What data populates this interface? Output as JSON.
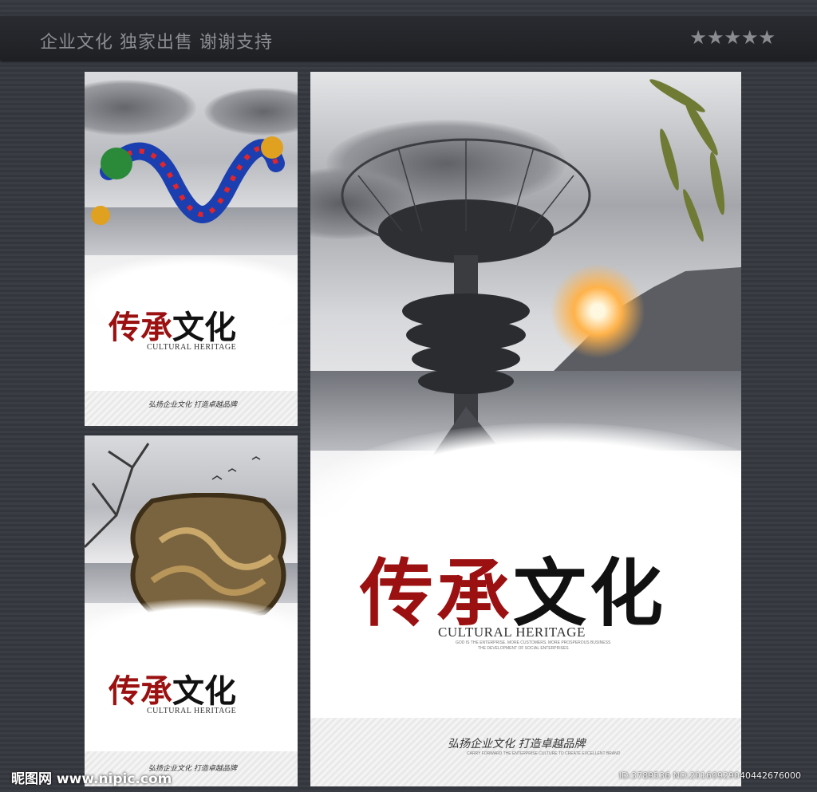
{
  "header": {
    "title": "企业文化  独家出售  谢谢支持",
    "stars": "★★★★★"
  },
  "posters": {
    "small_top": {
      "title_red": "传承",
      "title_black": "文化",
      "english": "CULTURAL HERITAGE",
      "slogan": "弘扬企业文化  打造卓越品牌"
    },
    "small_bottom": {
      "title_red": "传承",
      "title_black": "文化",
      "english": "CULTURAL HERITAGE",
      "slogan": "弘扬企业文化  打造卓越品牌"
    },
    "large": {
      "title_red": "传承",
      "title_black": "文化",
      "english": "CULTURAL HERITAGE",
      "sub_line1": "GOD IS THE ENTERPRISE. MORE CUSTOMERS. MORE PROSPEROUS BUSINESS",
      "sub_line2": "THE DEVELOPMENT OF SOCIAL ENTERPRISES",
      "slogan": "弘扬企业文化  打造卓越品牌",
      "slogan_sub": "CARRY FORWARD THE ENTERPRISE CULTURE TO CREATE EXCELLENT BRAND"
    }
  },
  "watermark": {
    "site": "昵图网 www.nipic.com",
    "id": "ID:3789536 NO:20160929040442676000"
  }
}
